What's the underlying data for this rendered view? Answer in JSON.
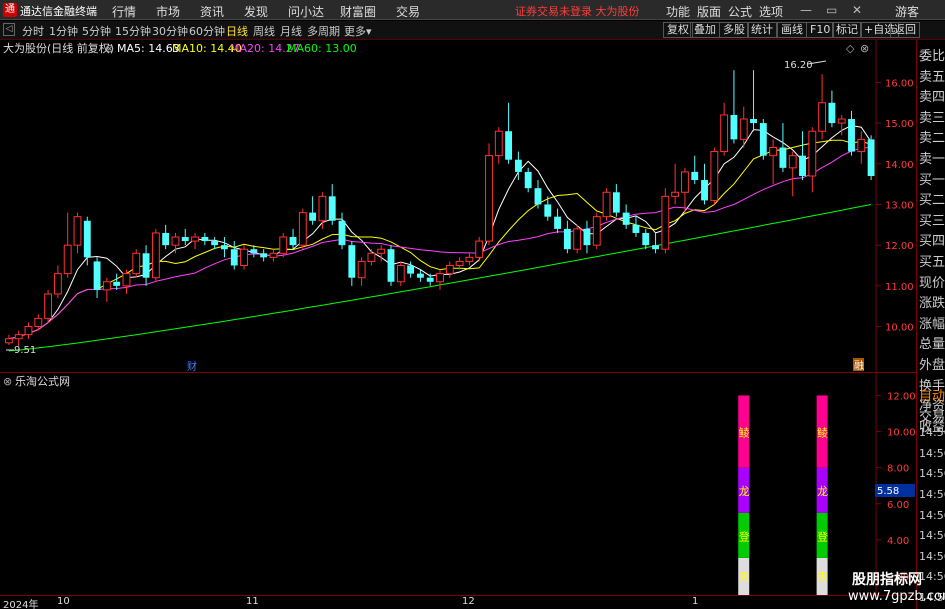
{
  "app": {
    "name": "通达信金融终端",
    "menus": [
      "行情",
      "市场",
      "资讯",
      "发现",
      "问小达",
      "财富圈",
      "交易"
    ],
    "notice": "证券交易未登录",
    "stock_name_top": "大为股份",
    "right_menus": [
      "功能",
      "版面",
      "公式",
      "选项"
    ],
    "user": "游客"
  },
  "toolbar": {
    "periods": [
      "分时",
      "1分钟",
      "5分钟",
      "15分钟",
      "30分钟",
      "60分钟",
      "日线",
      "周线",
      "月线",
      "多周期",
      "更多"
    ],
    "active_period": "日线",
    "buttons": [
      "复权",
      "叠加",
      "多股",
      "统计",
      "画线",
      "F10",
      "标记",
      "+自选",
      "返回"
    ]
  },
  "main_chart": {
    "header": "大为股份(日线 前复权)",
    "ma_labels": [
      {
        "name": "MA5: 14.63",
        "color": "#ffffff"
      },
      {
        "name": "MA10: 14.40",
        "color": "#ffff00"
      },
      {
        "name": "MA20: 14.27",
        "color": "#ff40ff"
      },
      {
        "name": "MA60: 13.00",
        "color": "#00ff00"
      }
    ],
    "high_annotation": "16.20",
    "low_annotation": "9.51",
    "cai_label": "财",
    "hui_label": "融",
    "settings_icons": [
      "◇",
      "⊗"
    ]
  },
  "sub_chart": {
    "header": "乐淘公式网",
    "y_value": "5.58",
    "bar_labels": [
      "鲮",
      "龙",
      "登",
      "天"
    ]
  },
  "timeaxis": {
    "labels": [
      "2024年",
      "10",
      "11",
      "12",
      "1"
    ]
  },
  "rightpanel": {
    "items": [
      "委比",
      "卖五",
      "卖四",
      "卖三",
      "卖二",
      "卖一",
      "买一",
      "买二",
      "买三",
      "买四",
      "买五",
      "现价",
      "涨跌",
      "涨幅",
      "总量",
      "外盘",
      "换手",
      "净资",
      "收益",
      "自动",
      "交易",
      "14:56",
      "14:56",
      "14:56",
      "14:56",
      "14:56",
      "14:56",
      "14:56",
      "14:56",
      "14:56"
    ]
  },
  "watermark": {
    "title": "股朋指标网",
    "url": "www.7gpzb.com"
  },
  "chart_data": [
    {
      "type": "candlestick",
      "title": "大为股份(日线 前复权)",
      "y_ticks": [
        10.0,
        11.0,
        12.0,
        13.0,
        14.0,
        15.0,
        16.0
      ],
      "ylim": [
        9.3,
        16.6
      ],
      "candles": [
        {
          "o": 9.6,
          "h": 9.8,
          "l": 9.55,
          "c": 9.7
        },
        {
          "o": 9.7,
          "h": 9.9,
          "l": 9.51,
          "c": 9.8
        },
        {
          "o": 9.8,
          "h": 10.1,
          "l": 9.7,
          "c": 10.0
        },
        {
          "o": 10.0,
          "h": 10.3,
          "l": 9.9,
          "c": 10.2
        },
        {
          "o": 10.2,
          "h": 10.9,
          "l": 10.1,
          "c": 10.8
        },
        {
          "o": 10.8,
          "h": 11.5,
          "l": 10.7,
          "c": 11.3
        },
        {
          "o": 11.3,
          "h": 12.8,
          "l": 11.2,
          "c": 12.0
        },
        {
          "o": 12.0,
          "h": 12.8,
          "l": 11.8,
          "c": 12.7
        },
        {
          "o": 12.6,
          "h": 12.7,
          "l": 11.5,
          "c": 11.7
        },
        {
          "o": 11.6,
          "h": 11.7,
          "l": 10.7,
          "c": 10.9
        },
        {
          "o": 10.9,
          "h": 11.2,
          "l": 10.6,
          "c": 11.1
        },
        {
          "o": 11.1,
          "h": 11.3,
          "l": 10.9,
          "c": 11.0
        },
        {
          "o": 11.0,
          "h": 11.4,
          "l": 10.8,
          "c": 11.3
        },
        {
          "o": 11.3,
          "h": 11.9,
          "l": 11.2,
          "c": 11.8
        },
        {
          "o": 11.8,
          "h": 12.0,
          "l": 11.0,
          "c": 11.2
        },
        {
          "o": 11.2,
          "h": 12.4,
          "l": 11.1,
          "c": 12.3
        },
        {
          "o": 12.3,
          "h": 12.5,
          "l": 11.9,
          "c": 12.0
        },
        {
          "o": 12.0,
          "h": 12.3,
          "l": 11.8,
          "c": 12.2
        },
        {
          "o": 12.2,
          "h": 12.4,
          "l": 12.0,
          "c": 12.1
        },
        {
          "o": 12.1,
          "h": 12.3,
          "l": 11.9,
          "c": 12.2
        },
        {
          "o": 12.2,
          "h": 12.3,
          "l": 12.0,
          "c": 12.1
        },
        {
          "o": 12.1,
          "h": 12.2,
          "l": 11.9,
          "c": 12.0
        },
        {
          "o": 12.0,
          "h": 12.2,
          "l": 11.7,
          "c": 11.9
        },
        {
          "o": 11.9,
          "h": 12.1,
          "l": 11.4,
          "c": 11.5
        },
        {
          "o": 11.5,
          "h": 12.0,
          "l": 11.4,
          "c": 11.9
        },
        {
          "o": 11.9,
          "h": 12.0,
          "l": 11.7,
          "c": 11.8
        },
        {
          "o": 11.8,
          "h": 11.9,
          "l": 11.6,
          "c": 11.7
        },
        {
          "o": 11.7,
          "h": 11.9,
          "l": 11.6,
          "c": 11.8
        },
        {
          "o": 11.8,
          "h": 12.3,
          "l": 11.7,
          "c": 12.2
        },
        {
          "o": 12.2,
          "h": 12.4,
          "l": 11.9,
          "c": 12.0
        },
        {
          "o": 12.0,
          "h": 12.9,
          "l": 11.9,
          "c": 12.8
        },
        {
          "o": 12.8,
          "h": 13.2,
          "l": 12.5,
          "c": 12.6
        },
        {
          "o": 12.6,
          "h": 13.3,
          "l": 12.4,
          "c": 13.2
        },
        {
          "o": 13.2,
          "h": 13.5,
          "l": 12.5,
          "c": 12.6
        },
        {
          "o": 12.6,
          "h": 12.8,
          "l": 11.9,
          "c": 12.0
        },
        {
          "o": 12.0,
          "h": 12.1,
          "l": 11.0,
          "c": 11.2
        },
        {
          "o": 11.2,
          "h": 11.7,
          "l": 11.0,
          "c": 11.6
        },
        {
          "o": 11.6,
          "h": 11.9,
          "l": 11.5,
          "c": 11.8
        },
        {
          "o": 11.8,
          "h": 12.0,
          "l": 11.6,
          "c": 11.9
        },
        {
          "o": 11.9,
          "h": 12.0,
          "l": 11.0,
          "c": 11.1
        },
        {
          "o": 11.1,
          "h": 11.6,
          "l": 11.0,
          "c": 11.5
        },
        {
          "o": 11.5,
          "h": 11.6,
          "l": 11.2,
          "c": 11.3
        },
        {
          "o": 11.3,
          "h": 11.4,
          "l": 11.1,
          "c": 11.2
        },
        {
          "o": 11.2,
          "h": 11.3,
          "l": 11.0,
          "c": 11.1
        },
        {
          "o": 11.1,
          "h": 11.4,
          "l": 10.9,
          "c": 11.3
        },
        {
          "o": 11.3,
          "h": 11.6,
          "l": 11.2,
          "c": 11.5
        },
        {
          "o": 11.5,
          "h": 11.7,
          "l": 11.4,
          "c": 11.6
        },
        {
          "o": 11.6,
          "h": 11.8,
          "l": 11.5,
          "c": 11.7
        },
        {
          "o": 11.7,
          "h": 12.2,
          "l": 11.6,
          "c": 12.1
        },
        {
          "o": 12.1,
          "h": 14.5,
          "l": 12.0,
          "c": 14.2
        },
        {
          "o": 14.2,
          "h": 14.9,
          "l": 14.0,
          "c": 14.8
        },
        {
          "o": 14.8,
          "h": 15.5,
          "l": 14.0,
          "c": 14.1
        },
        {
          "o": 14.1,
          "h": 14.3,
          "l": 13.6,
          "c": 13.8
        },
        {
          "o": 13.8,
          "h": 13.9,
          "l": 13.3,
          "c": 13.4
        },
        {
          "o": 13.4,
          "h": 13.6,
          "l": 12.9,
          "c": 13.0
        },
        {
          "o": 13.0,
          "h": 13.2,
          "l": 12.6,
          "c": 12.7
        },
        {
          "o": 12.7,
          "h": 12.9,
          "l": 12.3,
          "c": 12.4
        },
        {
          "o": 12.4,
          "h": 12.6,
          "l": 11.8,
          "c": 11.9
        },
        {
          "o": 11.9,
          "h": 12.5,
          "l": 11.8,
          "c": 12.4
        },
        {
          "o": 12.4,
          "h": 12.6,
          "l": 11.8,
          "c": 12.0
        },
        {
          "o": 12.0,
          "h": 12.8,
          "l": 11.9,
          "c": 12.7
        },
        {
          "o": 12.7,
          "h": 13.4,
          "l": 12.6,
          "c": 13.3
        },
        {
          "o": 13.3,
          "h": 13.5,
          "l": 12.7,
          "c": 12.8
        },
        {
          "o": 12.8,
          "h": 13.0,
          "l": 12.4,
          "c": 12.5
        },
        {
          "o": 12.5,
          "h": 12.7,
          "l": 12.2,
          "c": 12.3
        },
        {
          "o": 12.3,
          "h": 12.4,
          "l": 11.9,
          "c": 12.0
        },
        {
          "o": 12.0,
          "h": 12.3,
          "l": 11.8,
          "c": 11.9
        },
        {
          "o": 11.9,
          "h": 13.4,
          "l": 11.8,
          "c": 13.2
        },
        {
          "o": 13.2,
          "h": 14.0,
          "l": 13.0,
          "c": 13.3
        },
        {
          "o": 13.3,
          "h": 13.9,
          "l": 12.8,
          "c": 13.8
        },
        {
          "o": 13.8,
          "h": 14.2,
          "l": 13.5,
          "c": 13.6
        },
        {
          "o": 13.6,
          "h": 14.0,
          "l": 13.0,
          "c": 13.1
        },
        {
          "o": 13.1,
          "h": 14.4,
          "l": 13.0,
          "c": 14.3
        },
        {
          "o": 14.3,
          "h": 15.5,
          "l": 14.2,
          "c": 15.2
        },
        {
          "o": 15.2,
          "h": 16.3,
          "l": 14.5,
          "c": 14.6
        },
        {
          "o": 14.6,
          "h": 15.4,
          "l": 14.4,
          "c": 15.1
        },
        {
          "o": 15.1,
          "h": 16.3,
          "l": 14.8,
          "c": 15.0
        },
        {
          "o": 15.0,
          "h": 15.1,
          "l": 14.1,
          "c": 14.2
        },
        {
          "o": 14.2,
          "h": 14.6,
          "l": 13.5,
          "c": 14.4
        },
        {
          "o": 14.4,
          "h": 15.0,
          "l": 13.8,
          "c": 13.9
        },
        {
          "o": 13.9,
          "h": 14.3,
          "l": 13.2,
          "c": 14.2
        },
        {
          "o": 14.2,
          "h": 14.8,
          "l": 13.6,
          "c": 13.7
        },
        {
          "o": 13.7,
          "h": 14.9,
          "l": 13.3,
          "c": 14.8
        },
        {
          "o": 14.8,
          "h": 16.2,
          "l": 14.6,
          "c": 15.5
        },
        {
          "o": 15.5,
          "h": 15.8,
          "l": 14.9,
          "c": 15.0
        },
        {
          "o": 15.0,
          "h": 15.2,
          "l": 14.7,
          "c": 15.1
        },
        {
          "o": 15.1,
          "h": 15.3,
          "l": 14.2,
          "c": 14.3
        },
        {
          "o": 14.3,
          "h": 14.8,
          "l": 14.0,
          "c": 14.6
        },
        {
          "o": 14.6,
          "h": 14.7,
          "l": 13.6,
          "c": 13.7
        }
      ]
    },
    {
      "type": "bar",
      "title": "乐淘公式网",
      "y_ticks": [
        2.0,
        4.0,
        6.0,
        8.0,
        10.0,
        12.0
      ],
      "ylim": [
        1.5,
        12.8
      ],
      "stacked_bars": [
        {
          "index": 75,
          "segments": [
            {
              "label": "天",
              "from": 0,
              "to": 3.0,
              "color": "#dddddd"
            },
            {
              "label": "登",
              "from": 3.0,
              "to": 5.5,
              "color": "#00cc00"
            },
            {
              "label": "龙",
              "from": 5.5,
              "to": 8.0,
              "color": "#aa00ff"
            },
            {
              "label": "鲮",
              "from": 8.0,
              "to": 12.0,
              "color": "#ff0090"
            }
          ]
        },
        {
          "index": 83,
          "segments": [
            {
              "label": "天",
              "from": 0,
              "to": 3.0,
              "color": "#dddddd"
            },
            {
              "label": "登",
              "from": 3.0,
              "to": 5.5,
              "color": "#00cc00"
            },
            {
              "label": "龙",
              "from": 5.5,
              "to": 8.0,
              "color": "#aa00ff"
            },
            {
              "label": "鲮",
              "from": 8.0,
              "to": 12.0,
              "color": "#ff0090"
            }
          ]
        }
      ]
    }
  ]
}
